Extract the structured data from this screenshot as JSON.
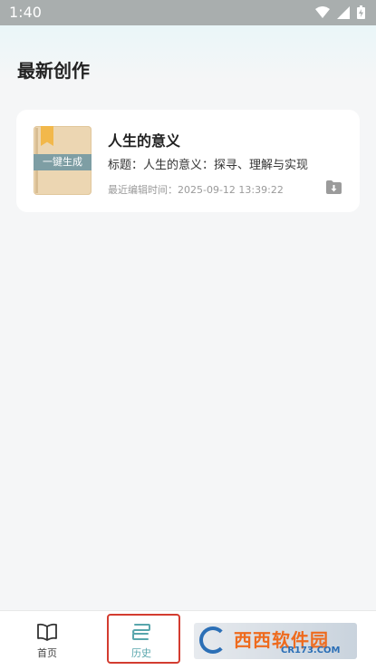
{
  "status_bar": {
    "time": "1:40"
  },
  "page": {
    "title": "最新创作"
  },
  "card": {
    "cover_label": "一键生成",
    "title": "人生的意义",
    "subtitle": "标题：人生的意义：探寻、理解与实现",
    "last_edited": "最近编辑时间：2025-09-12 13:39:22"
  },
  "nav": {
    "items": [
      {
        "label": "首页",
        "icon": "book-icon"
      },
      {
        "label": "历史",
        "icon": "history-icon"
      }
    ]
  },
  "watermark": {
    "text": "西西软件园",
    "site": "CR173.COM"
  },
  "colors": {
    "accent": "#58a6ac",
    "highlight": "#d33c30",
    "band": "#7e9ea4"
  }
}
